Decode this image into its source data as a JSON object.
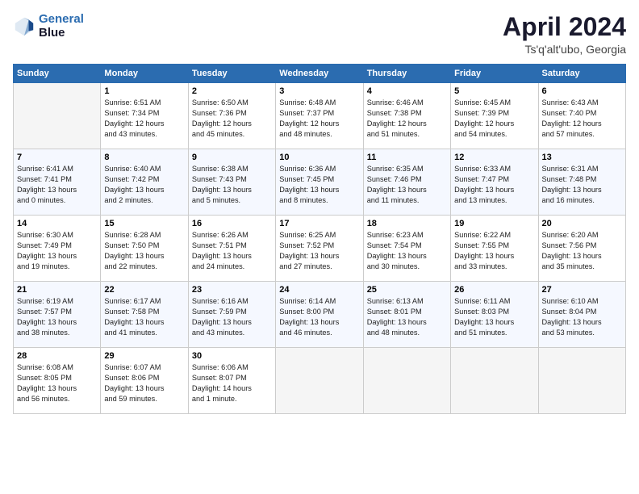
{
  "header": {
    "logo_line1": "General",
    "logo_line2": "Blue",
    "month_title": "April 2024",
    "subtitle": "Ts'q'alt'ubo, Georgia"
  },
  "days_of_week": [
    "Sunday",
    "Monday",
    "Tuesday",
    "Wednesday",
    "Thursday",
    "Friday",
    "Saturday"
  ],
  "weeks": [
    [
      {
        "day": "",
        "info": ""
      },
      {
        "day": "1",
        "info": "Sunrise: 6:51 AM\nSunset: 7:34 PM\nDaylight: 12 hours\nand 43 minutes."
      },
      {
        "day": "2",
        "info": "Sunrise: 6:50 AM\nSunset: 7:36 PM\nDaylight: 12 hours\nand 45 minutes."
      },
      {
        "day": "3",
        "info": "Sunrise: 6:48 AM\nSunset: 7:37 PM\nDaylight: 12 hours\nand 48 minutes."
      },
      {
        "day": "4",
        "info": "Sunrise: 6:46 AM\nSunset: 7:38 PM\nDaylight: 12 hours\nand 51 minutes."
      },
      {
        "day": "5",
        "info": "Sunrise: 6:45 AM\nSunset: 7:39 PM\nDaylight: 12 hours\nand 54 minutes."
      },
      {
        "day": "6",
        "info": "Sunrise: 6:43 AM\nSunset: 7:40 PM\nDaylight: 12 hours\nand 57 minutes."
      }
    ],
    [
      {
        "day": "7",
        "info": "Sunrise: 6:41 AM\nSunset: 7:41 PM\nDaylight: 13 hours\nand 0 minutes."
      },
      {
        "day": "8",
        "info": "Sunrise: 6:40 AM\nSunset: 7:42 PM\nDaylight: 13 hours\nand 2 minutes."
      },
      {
        "day": "9",
        "info": "Sunrise: 6:38 AM\nSunset: 7:43 PM\nDaylight: 13 hours\nand 5 minutes."
      },
      {
        "day": "10",
        "info": "Sunrise: 6:36 AM\nSunset: 7:45 PM\nDaylight: 13 hours\nand 8 minutes."
      },
      {
        "day": "11",
        "info": "Sunrise: 6:35 AM\nSunset: 7:46 PM\nDaylight: 13 hours\nand 11 minutes."
      },
      {
        "day": "12",
        "info": "Sunrise: 6:33 AM\nSunset: 7:47 PM\nDaylight: 13 hours\nand 13 minutes."
      },
      {
        "day": "13",
        "info": "Sunrise: 6:31 AM\nSunset: 7:48 PM\nDaylight: 13 hours\nand 16 minutes."
      }
    ],
    [
      {
        "day": "14",
        "info": "Sunrise: 6:30 AM\nSunset: 7:49 PM\nDaylight: 13 hours\nand 19 minutes."
      },
      {
        "day": "15",
        "info": "Sunrise: 6:28 AM\nSunset: 7:50 PM\nDaylight: 13 hours\nand 22 minutes."
      },
      {
        "day": "16",
        "info": "Sunrise: 6:26 AM\nSunset: 7:51 PM\nDaylight: 13 hours\nand 24 minutes."
      },
      {
        "day": "17",
        "info": "Sunrise: 6:25 AM\nSunset: 7:52 PM\nDaylight: 13 hours\nand 27 minutes."
      },
      {
        "day": "18",
        "info": "Sunrise: 6:23 AM\nSunset: 7:54 PM\nDaylight: 13 hours\nand 30 minutes."
      },
      {
        "day": "19",
        "info": "Sunrise: 6:22 AM\nSunset: 7:55 PM\nDaylight: 13 hours\nand 33 minutes."
      },
      {
        "day": "20",
        "info": "Sunrise: 6:20 AM\nSunset: 7:56 PM\nDaylight: 13 hours\nand 35 minutes."
      }
    ],
    [
      {
        "day": "21",
        "info": "Sunrise: 6:19 AM\nSunset: 7:57 PM\nDaylight: 13 hours\nand 38 minutes."
      },
      {
        "day": "22",
        "info": "Sunrise: 6:17 AM\nSunset: 7:58 PM\nDaylight: 13 hours\nand 41 minutes."
      },
      {
        "day": "23",
        "info": "Sunrise: 6:16 AM\nSunset: 7:59 PM\nDaylight: 13 hours\nand 43 minutes."
      },
      {
        "day": "24",
        "info": "Sunrise: 6:14 AM\nSunset: 8:00 PM\nDaylight: 13 hours\nand 46 minutes."
      },
      {
        "day": "25",
        "info": "Sunrise: 6:13 AM\nSunset: 8:01 PM\nDaylight: 13 hours\nand 48 minutes."
      },
      {
        "day": "26",
        "info": "Sunrise: 6:11 AM\nSunset: 8:03 PM\nDaylight: 13 hours\nand 51 minutes."
      },
      {
        "day": "27",
        "info": "Sunrise: 6:10 AM\nSunset: 8:04 PM\nDaylight: 13 hours\nand 53 minutes."
      }
    ],
    [
      {
        "day": "28",
        "info": "Sunrise: 6:08 AM\nSunset: 8:05 PM\nDaylight: 13 hours\nand 56 minutes."
      },
      {
        "day": "29",
        "info": "Sunrise: 6:07 AM\nSunset: 8:06 PM\nDaylight: 13 hours\nand 59 minutes."
      },
      {
        "day": "30",
        "info": "Sunrise: 6:06 AM\nSunset: 8:07 PM\nDaylight: 14 hours\nand 1 minute."
      },
      {
        "day": "",
        "info": ""
      },
      {
        "day": "",
        "info": ""
      },
      {
        "day": "",
        "info": ""
      },
      {
        "day": "",
        "info": ""
      }
    ]
  ]
}
